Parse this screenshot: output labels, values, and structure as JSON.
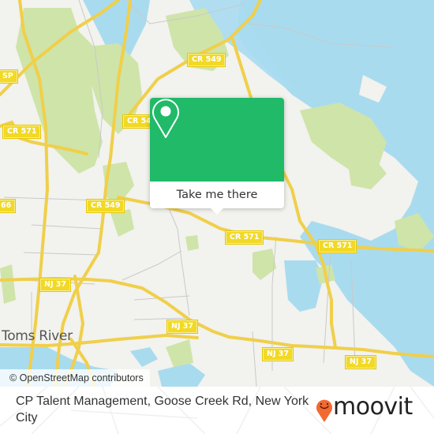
{
  "map": {
    "colors": {
      "land": "#f2f2ee",
      "water": "#a9dbef",
      "park": "#cfe4a9",
      "road_major": "#f7dc55",
      "road_minor": "#c9c9c9",
      "shield": "#f1d925"
    },
    "road_labels": [
      {
        "id": "cr549-top",
        "text": "CR 549"
      },
      {
        "id": "cr54-left",
        "text": "CR 54"
      },
      {
        "id": "cr571-left",
        "text": "CR 571"
      },
      {
        "id": "gsp-edge",
        "text": "SP"
      },
      {
        "id": "cr549-mid",
        "text": "CR 549"
      },
      {
        "id": "cr66-edge",
        "text": "66"
      },
      {
        "id": "cr571-center",
        "text": "CR 571"
      },
      {
        "id": "cr571-right",
        "text": "CR 571"
      },
      {
        "id": "nj37-left",
        "text": "NJ 37"
      },
      {
        "id": "nj37-center",
        "text": "NJ 37"
      },
      {
        "id": "nj37-lower",
        "text": "NJ 37"
      },
      {
        "id": "nj37-right",
        "text": "NJ 37"
      }
    ],
    "place_labels": [
      {
        "id": "toms-river",
        "text": "Toms River"
      }
    ],
    "attribution": "© OpenStreetMap contributors"
  },
  "popup": {
    "icon": "map-pin-icon",
    "button_label": "Take me there",
    "accent_color": "#20ba68"
  },
  "footer": {
    "title": "CP Talent Management, Goose Creek Rd, New York City",
    "brand": "moovit",
    "brand_icon": "moovit-pin-smile-icon",
    "brand_color": "#f26a32"
  }
}
